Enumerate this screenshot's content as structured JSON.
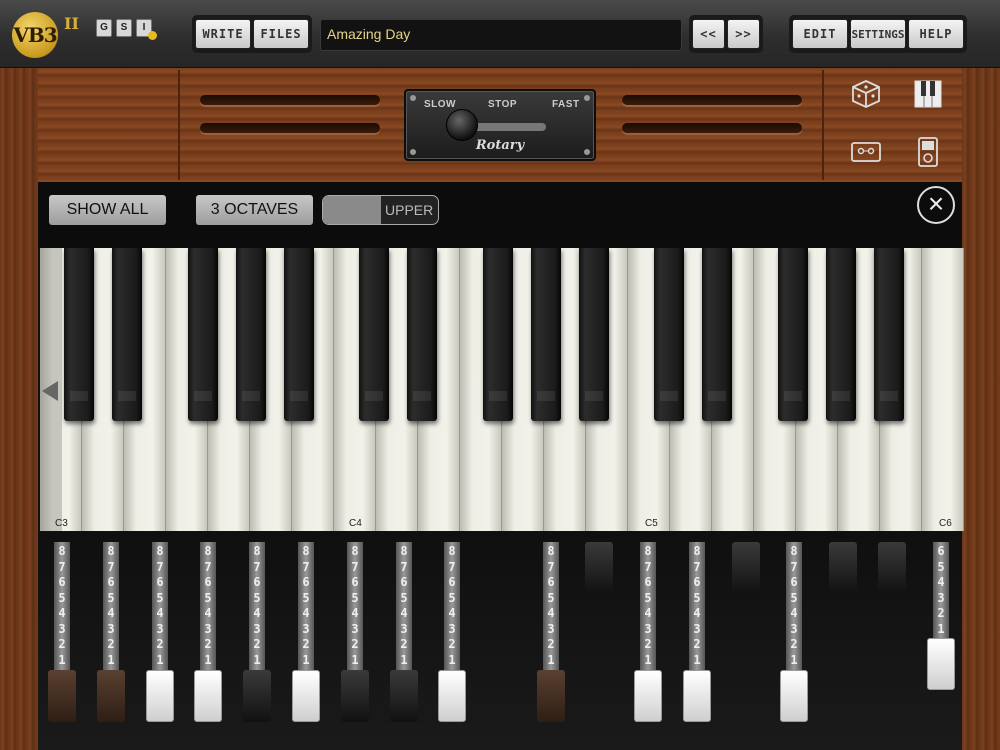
{
  "app": {
    "logo_text": "VB3",
    "logo_suffix": "II",
    "mini_buttons": [
      "G",
      "S",
      "I"
    ]
  },
  "toolbar": {
    "write_label": "WRITE",
    "files_label": "FILES",
    "preset_name": "Amazing Day",
    "prev_label": "<<",
    "next_label": ">>",
    "edit_label": "EDIT",
    "settings_label": "SETTINGS",
    "help_label": "HELP"
  },
  "rotary": {
    "slow_label": "SLOW",
    "stop_label": "STOP",
    "fast_label": "FAST",
    "name": "Rotary",
    "state": "slow"
  },
  "side_icons": [
    "dice-icon",
    "keyboard-icon",
    "cassette-icon",
    "ipod-icon"
  ],
  "keyboard": {
    "show_all_label": "SHOW ALL",
    "octaves_label": "3 OCTAVES",
    "manual_label": "UPPER",
    "note_labels": [
      "C3",
      "C4",
      "C5",
      "C6"
    ]
  },
  "drawbars": {
    "numbers": [
      "8",
      "7",
      "6",
      "5",
      "4",
      "3",
      "2",
      "1"
    ],
    "short_numbers": [
      "6",
      "5",
      "4",
      "3",
      "2",
      "1"
    ]
  }
}
